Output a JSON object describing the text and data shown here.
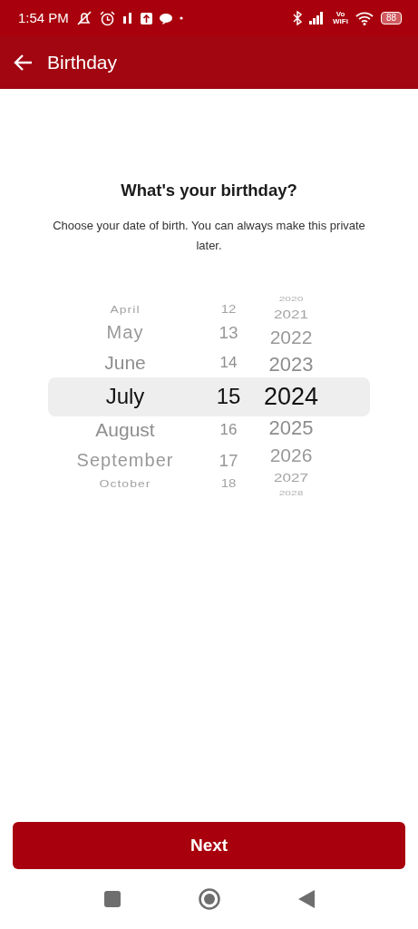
{
  "status_bar": {
    "time": "1:54 PM",
    "wifi_label": "Vo\nWiFi",
    "battery": "88"
  },
  "app_bar": {
    "title": "Birthday"
  },
  "heading": "What's your birthday?",
  "description": "Choose your date of birth. You can always make this private later.",
  "picker": {
    "months": [
      {
        "label": "April",
        "selected": false
      },
      {
        "label": "May",
        "selected": false
      },
      {
        "label": "June",
        "selected": false
      },
      {
        "label": "July",
        "selected": true
      },
      {
        "label": "August",
        "selected": false
      },
      {
        "label": "September",
        "selected": false
      },
      {
        "label": "October",
        "selected": false
      }
    ],
    "days": [
      {
        "label": "12",
        "selected": false
      },
      {
        "label": "13",
        "selected": false
      },
      {
        "label": "14",
        "selected": false
      },
      {
        "label": "15",
        "selected": true
      },
      {
        "label": "16",
        "selected": false
      },
      {
        "label": "17",
        "selected": false
      },
      {
        "label": "18",
        "selected": false
      }
    ],
    "years": [
      {
        "label": "2020",
        "selected": false
      },
      {
        "label": "2021",
        "selected": false
      },
      {
        "label": "2022",
        "selected": false
      },
      {
        "label": "2023",
        "selected": false
      },
      {
        "label": "2024",
        "selected": true
      },
      {
        "label": "2025",
        "selected": false
      },
      {
        "label": "2026",
        "selected": false
      },
      {
        "label": "2027",
        "selected": false
      },
      {
        "label": "2028",
        "selected": false
      }
    ]
  },
  "next_button": "Next"
}
